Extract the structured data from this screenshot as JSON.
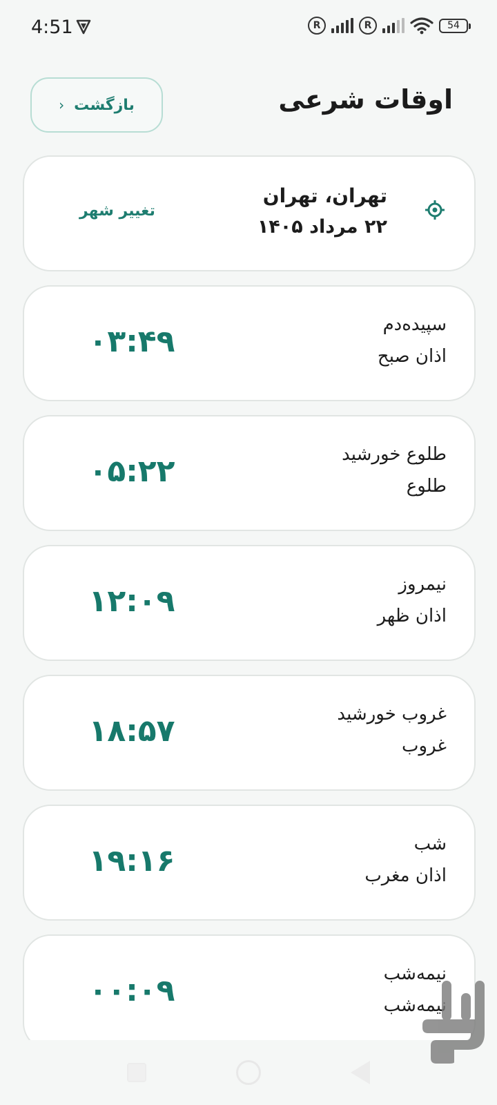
{
  "status_bar": {
    "time": "4:51",
    "battery": "54"
  },
  "header": {
    "title": "اوقات شرعی",
    "back_label": "بازگشت"
  },
  "location": {
    "city": "تهران، تهران",
    "date": "۲۲ مرداد ۱۴۰۵",
    "change_label": "تغییر شهر"
  },
  "prayers": [
    {
      "name": "سپیده‌دم",
      "sub": "اذان صبح",
      "time": "۰۳:۴۹"
    },
    {
      "name": "طلوع خورشید",
      "sub": "طلوع",
      "time": "۰۵:۲۲"
    },
    {
      "name": "نیمروز",
      "sub": "اذان ظهر",
      "time": "۱۲:۰۹"
    },
    {
      "name": "غروب خورشید",
      "sub": "غروب",
      "time": "۱۸:۵۷"
    },
    {
      "name": "شب",
      "sub": "اذان مغرب",
      "time": "۱۹:۱۶"
    },
    {
      "name": "نیمه‌شب",
      "sub": "نیمه‌شب",
      "time": "۰۰:۰۹"
    }
  ],
  "colors": {
    "accent": "#1e7d70",
    "background": "#f5f7f6",
    "card": "#ffffff"
  },
  "icons": {
    "location": "crosshair-icon",
    "back": "chevron-left-icon"
  }
}
